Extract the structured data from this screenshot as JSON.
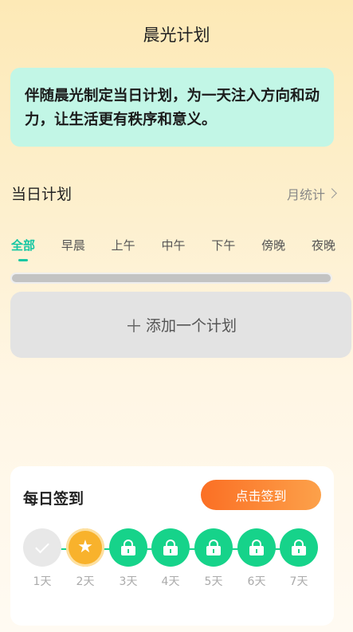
{
  "header": {
    "title": "晨光计划"
  },
  "banner": {
    "text": "伴随晨光制定当日计划，为一天注入方向和动力，让生活更有秩序和意义。"
  },
  "plans": {
    "title": "当日计划",
    "stats_link": "月统计"
  },
  "tabs": [
    {
      "label": "全部",
      "active": true
    },
    {
      "label": "早晨"
    },
    {
      "label": "上午"
    },
    {
      "label": "中午"
    },
    {
      "label": "下午"
    },
    {
      "label": "傍晚"
    },
    {
      "label": "夜晚"
    }
  ],
  "add_plan": {
    "label": "添加一个计划",
    "icon": "plus-icon"
  },
  "checkin": {
    "title": "每日签到",
    "button": "点击签到",
    "days": [
      {
        "label": "1天",
        "state": "done",
        "icon": "check-icon"
      },
      {
        "label": "2天",
        "state": "today",
        "icon": "star-icon"
      },
      {
        "label": "3天",
        "state": "locked",
        "icon": "lock-icon"
      },
      {
        "label": "4天",
        "state": "locked",
        "icon": "lock-icon"
      },
      {
        "label": "5天",
        "state": "locked",
        "icon": "lock-icon"
      },
      {
        "label": "6天",
        "state": "locked",
        "icon": "lock-icon"
      },
      {
        "label": "7天",
        "state": "locked",
        "icon": "lock-icon"
      }
    ]
  },
  "colors": {
    "accent": "#16c7a3",
    "lock_green": "#16d38a",
    "orange": "#fb6f24",
    "banner": "#c2f6e6"
  }
}
